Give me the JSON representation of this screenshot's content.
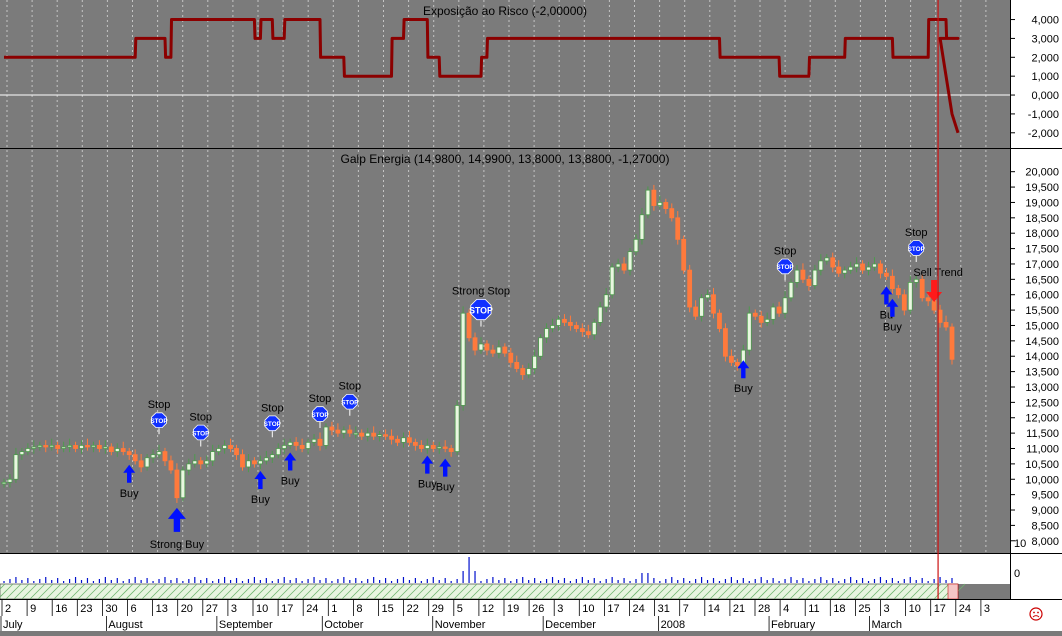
{
  "colors": {
    "panel_bg": "#7b7b7b",
    "grid": "#d8d8d8",
    "exposure_line": "#8b0000",
    "candle_up_fill": "#e9f7e0",
    "candle_up_line": "#4e9a4e",
    "candle_down": "#ff7a3c",
    "buy_arrow": "#0010ff",
    "sell_arrow": "#ff1a1a",
    "stop_sign": "#1030ff",
    "cursor_line": "#cc1111",
    "volume_bar": "#0010cc",
    "sad_face": "#cc0000"
  },
  "chart_data": [
    {
      "type": "line",
      "name": "exposure",
      "title": "Exposição ao Risco (-2,00000)",
      "y_ticks": [
        "4,000",
        "3,000",
        "2,000",
        "1,000",
        "0,000",
        "-1,000",
        "-2,000"
      ],
      "ylim": [
        -2.7,
        4.4
      ],
      "x_index": [
        0,
        22,
        22.1,
        27,
        27.1,
        28,
        28.1,
        42,
        42.1,
        43,
        43.1,
        45,
        45.1,
        47,
        47.1,
        53,
        53.1,
        57,
        57.1,
        65,
        65.1,
        67,
        67.1,
        68,
        68.1,
        71,
        71.1,
        73,
        73.1,
        80,
        80.1,
        81,
        81.1,
        120,
        120.1,
        130,
        130.1,
        135,
        135.1,
        141,
        141.1,
        149,
        149.1,
        155,
        155.1,
        158,
        158.1,
        160
      ],
      "values": [
        2,
        2,
        3,
        3,
        2,
        2,
        4,
        4,
        3,
        3,
        4,
        4,
        3,
        3,
        4,
        4,
        2,
        2,
        1,
        1,
        3,
        3,
        4,
        4,
        4,
        4,
        2,
        2,
        1,
        1,
        2,
        2,
        3,
        3,
        2,
        2,
        1,
        1,
        2,
        2,
        3,
        3,
        2,
        2,
        4,
        4,
        3,
        3,
        2,
        2,
        1,
        1,
        3,
        3,
        4,
        4,
        2,
        2,
        1,
        1,
        2,
        2
      ]
    },
    {
      "type": "candlestick",
      "name": "price",
      "title": "Galp Energia (14,9800, 14,9900, 13,8000, 13,8800, -1,27000)",
      "y_ticks": [
        "20,000",
        "19,500",
        "19,000",
        "18,500",
        "18,000",
        "17,500",
        "17,000",
        "16,500",
        "16,000",
        "15,500",
        "15,000",
        "14,500",
        "14,000",
        "13,500",
        "13,000",
        "12,500",
        "12,000",
        "11,500",
        "11,000",
        "10,500",
        "10,000",
        "9,500",
        "9,000",
        "8,500",
        "8,000"
      ],
      "ylim": [
        7.7,
        20.25
      ],
      "close": [
        9.9,
        10.0,
        10.8,
        10.9,
        11.0,
        11.05,
        11.1,
        11.05,
        11.1,
        11.0,
        11.05,
        11.1,
        11.0,
        11.1,
        11.05,
        11.1,
        11.0,
        11.05,
        10.9,
        11.0,
        10.9,
        10.8,
        10.6,
        10.4,
        10.7,
        10.8,
        10.9,
        10.6,
        10.3,
        9.4,
        10.3,
        10.5,
        10.6,
        10.5,
        10.6,
        10.9,
        11.0,
        11.1,
        11.0,
        10.8,
        10.4,
        10.6,
        10.5,
        10.6,
        10.7,
        10.8,
        11.0,
        11.1,
        11.2,
        11.1,
        11.0,
        11.2,
        11.3,
        11.1,
        11.7,
        11.6,
        11.5,
        11.6,
        11.5,
        11.5,
        11.4,
        11.5,
        11.4,
        11.45,
        11.4,
        11.3,
        11.2,
        11.35,
        11.2,
        11.1,
        11.0,
        11.1,
        11.0,
        11.05,
        11.0,
        10.9,
        12.4,
        15.4,
        14.6,
        14.2,
        14.4,
        14.2,
        14.1,
        14.3,
        14.1,
        13.8,
        13.6,
        13.4,
        13.6,
        14.0,
        14.6,
        14.9,
        15.0,
        15.2,
        15.1,
        15.0,
        14.9,
        14.8,
        14.7,
        15.1,
        15.6,
        16.0,
        16.9,
        17.0,
        16.8,
        17.4,
        17.8,
        18.6,
        19.4,
        18.9,
        19.0,
        18.8,
        18.5,
        17.8,
        16.8,
        15.6,
        15.3,
        15.9,
        16.0,
        15.4,
        14.9,
        14.0,
        13.8,
        13.7,
        14.2,
        15.4,
        15.3,
        15.1,
        15.2,
        15.6,
        15.4,
        15.9,
        16.4,
        16.8,
        16.5,
        16.3,
        16.8,
        17.1,
        17.2,
        16.9,
        16.7,
        16.8,
        16.9,
        17.0,
        16.8,
        16.9,
        17.0,
        16.7,
        16.6,
        16.2,
        16.0,
        15.5,
        16.4,
        16.5,
        15.9,
        15.8,
        15.5,
        15.1,
        14.95,
        13.9
      ],
      "signals": [
        {
          "label": "Buy",
          "index": 21,
          "kind": "buy"
        },
        {
          "label": "Strong Buy",
          "index": 29,
          "kind": "strong_buy"
        },
        {
          "label": "Buy",
          "index": 43,
          "kind": "buy"
        },
        {
          "label": "Buy",
          "index": 48,
          "kind": "buy"
        },
        {
          "label": "Buy",
          "index": 71,
          "kind": "buy"
        },
        {
          "label": "Buy",
          "index": 74,
          "kind": "buy"
        },
        {
          "label": "Buy",
          "index": 124,
          "kind": "buy"
        },
        {
          "label": "Bu",
          "index": 148,
          "kind": "buy"
        },
        {
          "label": "Buy",
          "index": 149,
          "kind": "buy"
        },
        {
          "label": "Stop",
          "index": 26,
          "kind": "stop"
        },
        {
          "label": "Stop",
          "index": 33,
          "kind": "stop"
        },
        {
          "label": "Stop",
          "index": 45,
          "kind": "stop"
        },
        {
          "label": "Stop",
          "index": 53,
          "kind": "stop"
        },
        {
          "label": "Stop",
          "index": 58,
          "kind": "stop"
        },
        {
          "label": "Strong Stop",
          "index": 80,
          "kind": "strong_stop"
        },
        {
          "label": "Stop",
          "index": 131,
          "kind": "stop"
        },
        {
          "label": "Stop",
          "index": 153,
          "kind": "stop"
        },
        {
          "label": "Sell Trend",
          "index": 156,
          "kind": "sell"
        }
      ]
    },
    {
      "type": "bar",
      "name": "volume",
      "y_ticks": [
        "10",
        "0"
      ]
    }
  ],
  "x_axis": {
    "day_labels": [
      "2",
      "9",
      "16",
      "23",
      "30",
      "6",
      "13",
      "20",
      "27",
      "3",
      "10",
      "17",
      "24",
      "1",
      "8",
      "15",
      "22",
      "29",
      "5",
      "12",
      "19",
      "26",
      "3",
      "10",
      "17",
      "24",
      "31",
      "7",
      "14",
      "21",
      "28",
      "4",
      "11",
      "18",
      "25",
      "3",
      "10",
      "17",
      "24",
      "3"
    ],
    "month_labels": [
      "July",
      "August",
      "September",
      "October",
      "November",
      "December",
      "2008",
      "February",
      "March"
    ]
  },
  "cursor_index": 157,
  "status_icon": "sad-face-icon"
}
